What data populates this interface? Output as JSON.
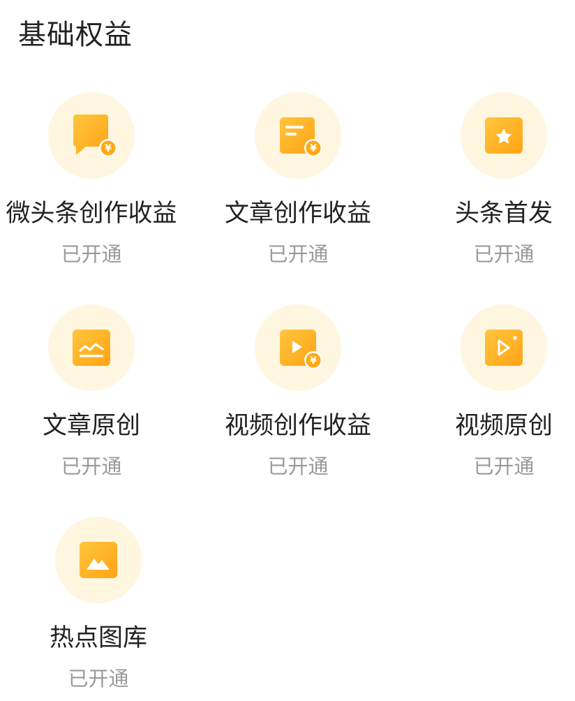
{
  "section": {
    "title": "基础权益"
  },
  "colors": {
    "circle_bg": "#fff6e0",
    "icon_gradient_start": "#ffc43a",
    "icon_gradient_end": "#ffa716",
    "status_text": "#9a9a9a"
  },
  "benefits": [
    {
      "name": "微头条创作收益",
      "status": "已开通",
      "icon": "chat-bubble-yen-icon"
    },
    {
      "name": "文章创作收益",
      "status": "已开通",
      "icon": "article-yen-icon"
    },
    {
      "name": "头条首发",
      "status": "已开通",
      "icon": "star-icon"
    },
    {
      "name": "文章原创",
      "status": "已开通",
      "icon": "chart-line-icon"
    },
    {
      "name": "视频创作收益",
      "status": "已开通",
      "icon": "video-yen-icon"
    },
    {
      "name": "视频原创",
      "status": "已开通",
      "icon": "video-play-icon"
    },
    {
      "name": "热点图库",
      "status": "已开通",
      "icon": "mountain-image-icon"
    }
  ]
}
